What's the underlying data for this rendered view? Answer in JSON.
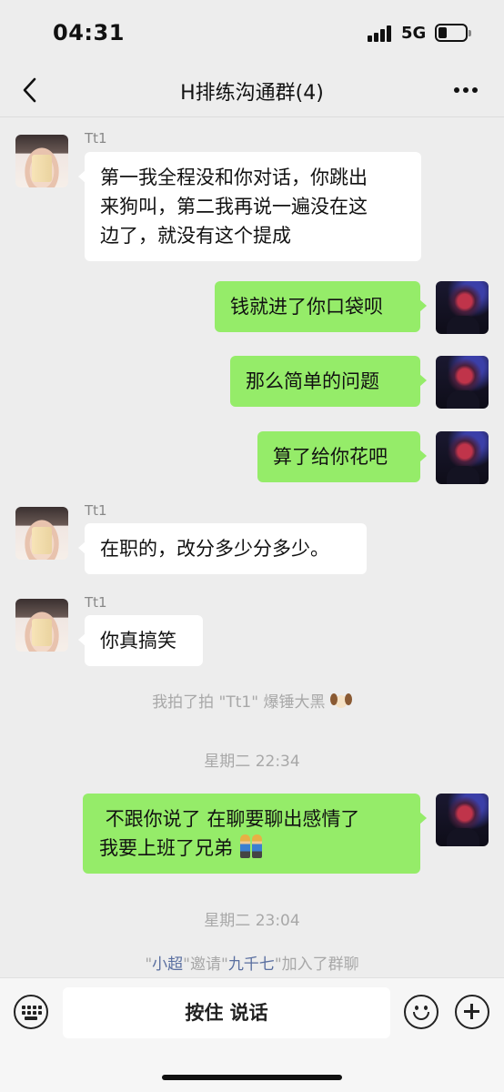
{
  "status": {
    "time": "04:31",
    "network": "5G"
  },
  "header": {
    "title": "H排练沟通群(4)"
  },
  "messages": [
    {
      "sender": "Tt1",
      "text": "第一我全程没和你对话，你跳出\n来狗叫，第二我再说一遍没在这\n边了，就没有这个提成"
    },
    {
      "text": "钱就进了你口袋呗"
    },
    {
      "text": "那么简单的问题"
    },
    {
      "text": "算了给你花吧"
    },
    {
      "sender": "Tt1",
      "text": "在职的，改分多少分多少。"
    },
    {
      "sender": "Tt1",
      "text": "你真搞笑"
    },
    {
      "text": " 不跟你说了 在聊要聊出感情了\n我要上班了兄弟 "
    }
  ],
  "system": {
    "pat": "我拍了拍 \"Tt1\" 爆锤大黑",
    "time1": "星期二 22:34",
    "time2": "星期二 23:04",
    "invite_q1": "\"",
    "invite_user1": "小超",
    "invite_mid": "\"邀请\"",
    "invite_user2": "九千七",
    "invite_tail": "\"加入了群聊"
  },
  "input_bar": {
    "hold_to_talk": "按住 说话"
  },
  "icons": {
    "back": "chevron-left-icon",
    "more": "more-dots-icon",
    "keyboard": "keyboard-icon",
    "emoji": "smiley-icon",
    "plus": "plus-circle-icon",
    "pat_emoji": "dog-face-emoji",
    "msg_emoji": "two-men-holding-hands-emoji"
  },
  "colors": {
    "background": "#ededed",
    "bubble_out": "#95ec69",
    "bubble_in": "#ffffff",
    "system_text": "#a8a8a8",
    "link": "#5a6fa0"
  }
}
